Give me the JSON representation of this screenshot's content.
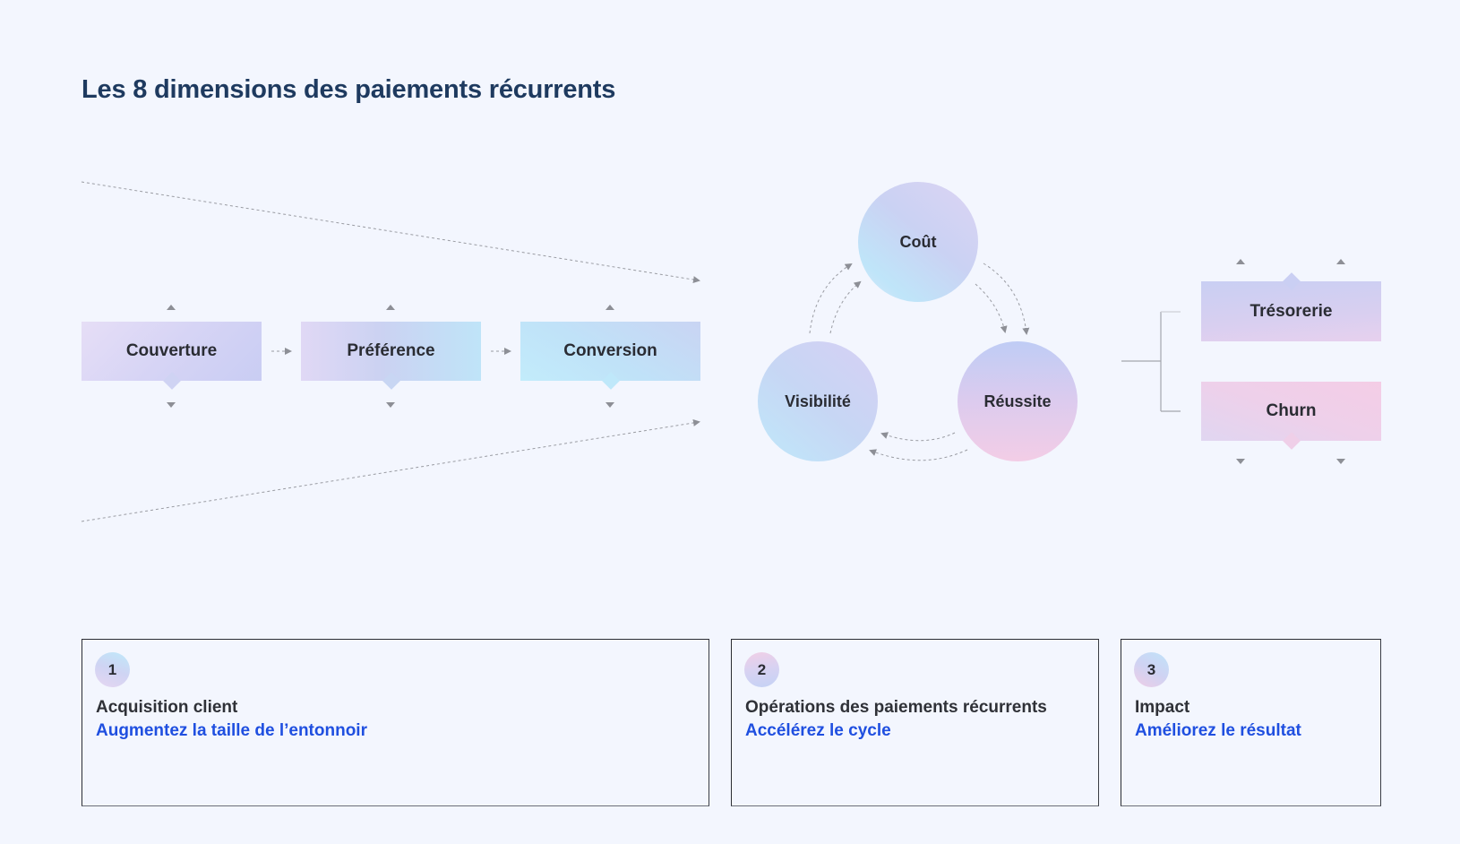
{
  "title": "Les 8 dimensions des paiements récurrents",
  "funnel": {
    "stages": [
      {
        "label": "Couverture"
      },
      {
        "label": "Préférence"
      },
      {
        "label": "Conversion"
      }
    ]
  },
  "cycle": {
    "nodes": [
      {
        "label": "Coût"
      },
      {
        "label": "Visibilité"
      },
      {
        "label": "Réussite"
      }
    ]
  },
  "impact": {
    "items": [
      {
        "label": "Trésorerie"
      },
      {
        "label": "Churn"
      }
    ]
  },
  "cards": [
    {
      "number": "1",
      "heading": "Acquisition client",
      "subheading": "Augmentez la taille de l’entonnoir"
    },
    {
      "number": "2",
      "heading": "Opérations des paiements récurrents",
      "subheading": "Accélérez le cycle"
    },
    {
      "number": "3",
      "heading": "Impact",
      "subheading": "Améliorez le résultat"
    }
  ],
  "colors": {
    "background": "#f3f6fe",
    "title": "#1e3a5f",
    "accent_link": "#1f4fe0",
    "text": "#2a2c33"
  }
}
